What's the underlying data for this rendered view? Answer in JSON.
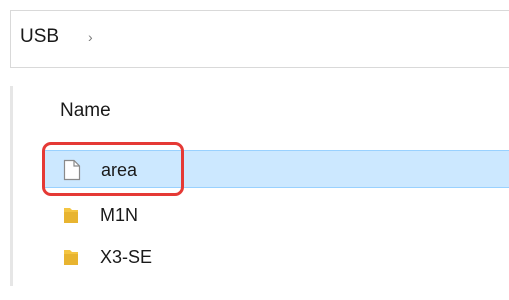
{
  "address_bar": {
    "breadcrumb": [
      "USB"
    ],
    "separator": "›"
  },
  "file_list": {
    "column_header": "Name",
    "items": [
      {
        "name": "area",
        "icon": "document-icon",
        "selected": true
      },
      {
        "name": "M1N",
        "icon": "folder-icon",
        "selected": false
      },
      {
        "name": "X3-SE",
        "icon": "folder-icon",
        "selected": false
      }
    ]
  },
  "colors": {
    "selection_fill": "#cce8ff",
    "selection_border": "#99d1ff",
    "annotation": "#e53935",
    "folder": "#f4c542"
  }
}
